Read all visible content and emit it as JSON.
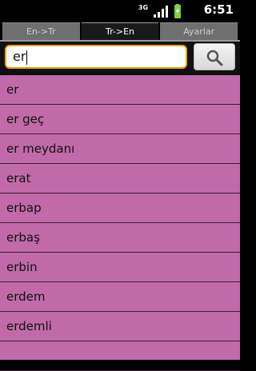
{
  "statusbar": {
    "network": "3G",
    "time": "6:51",
    "icons": [
      "network-3g-icon",
      "signal-icon",
      "battery-charging-icon"
    ]
  },
  "tabs": [
    {
      "label": "En->Tr",
      "active": false
    },
    {
      "label": "Tr->En",
      "active": true
    },
    {
      "label": "Ayarlar",
      "active": false
    }
  ],
  "search": {
    "value": "er",
    "placeholder": "",
    "button_icon": "search-icon"
  },
  "list": {
    "items": [
      "er",
      "er geç",
      "er meydanı",
      "erat",
      "erbap",
      "erbaş",
      "erbin",
      "erdem",
      "erdemli",
      ""
    ]
  },
  "colors": {
    "list_background": "#c06aaa",
    "input_border": "#f1a300"
  }
}
